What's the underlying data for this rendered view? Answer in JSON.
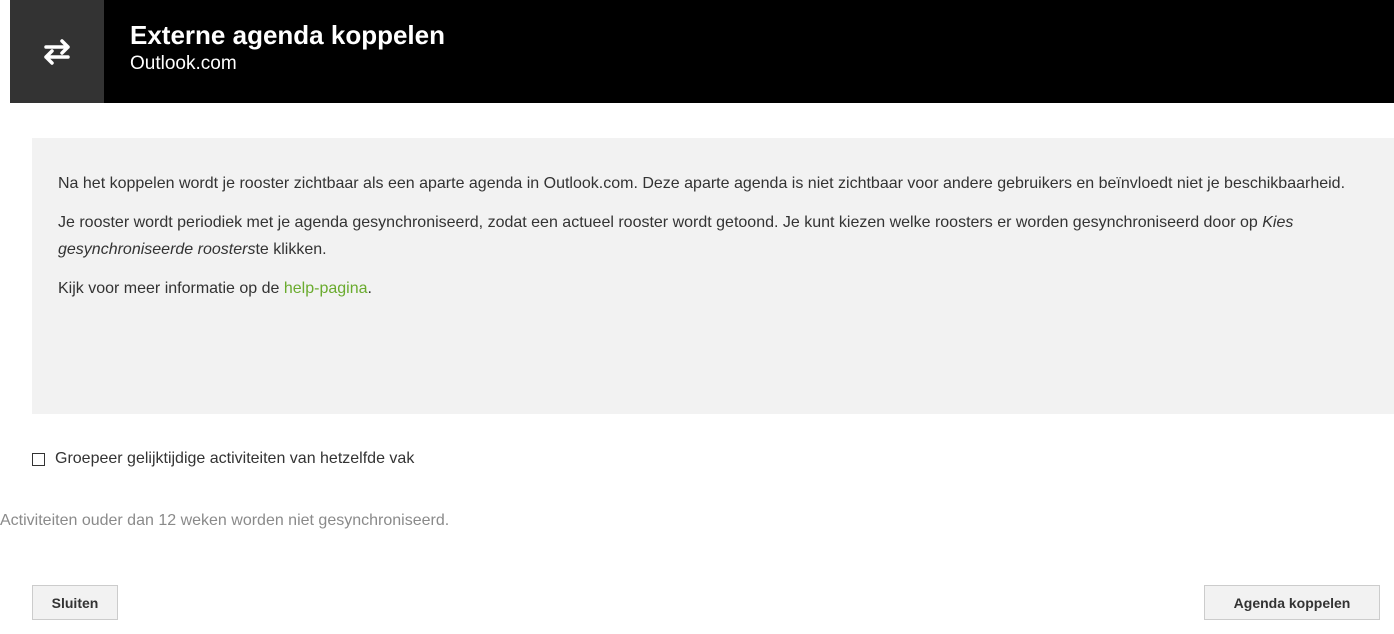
{
  "header": {
    "icon": "swap-arrows-icon",
    "title": "Externe agenda koppelen",
    "subtitle": "Outlook.com"
  },
  "info": {
    "paragraph1": "Na het koppelen wordt je rooster zichtbaar als een aparte agenda in Outlook.com. Deze aparte agenda is niet zichtbaar voor andere gebruikers en beïnvloedt niet je beschikbaarheid.",
    "paragraph2_before": "Je rooster wordt periodiek met je agenda gesynchroniseerd, zodat een actueel rooster wordt getoond. Je kunt kiezen welke roosters er worden gesynchroniseerd door op ",
    "paragraph2_emphasis": "Kies gesynchroniseerde roosters",
    "paragraph2_after": "te klikken.",
    "paragraph3_before": "Kijk voor meer informatie op de ",
    "help_link": "help-pagina",
    "paragraph3_after": "."
  },
  "option": {
    "label": "Groepeer gelijktijdige activiteiten van hetzelfde vak",
    "checked": false
  },
  "note": "Activiteiten ouder dan 12 weken worden niet gesynchroniseerd.",
  "buttons": {
    "close": "Sluiten",
    "connect": "Agenda koppelen"
  },
  "colors": {
    "header_bg": "#000000",
    "icon_bg": "#333333",
    "info_bg": "#f2f2f2",
    "link": "#6aab2e",
    "note_text": "#8a8a8a"
  }
}
